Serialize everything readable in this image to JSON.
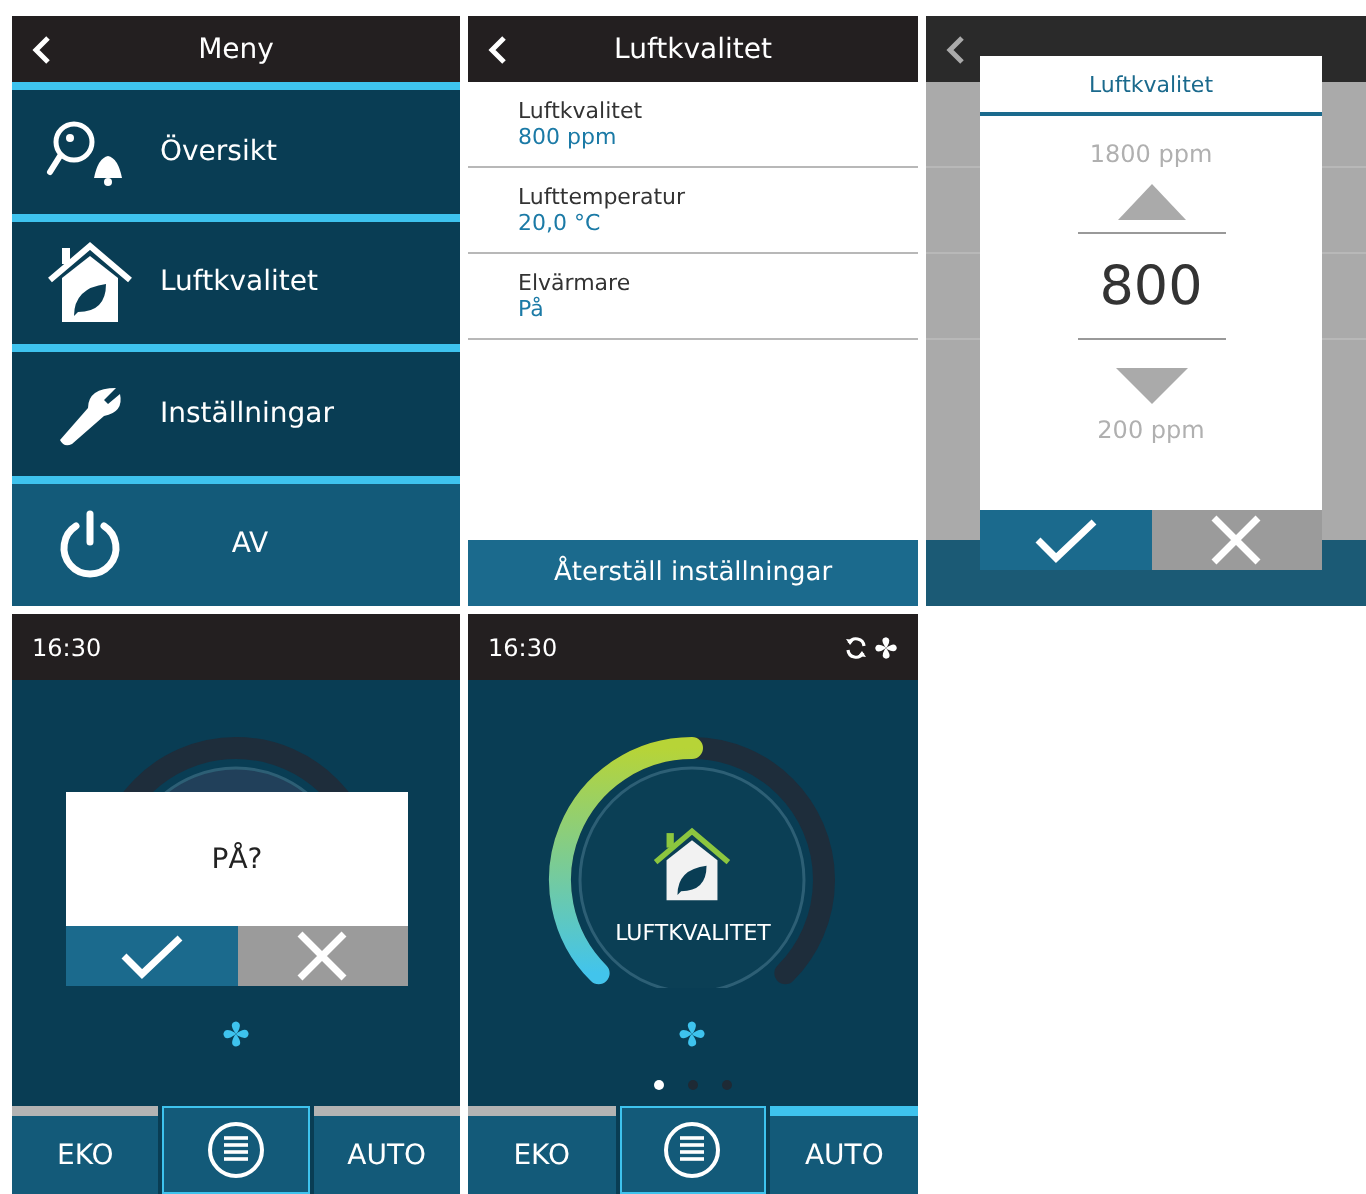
{
  "menu_screen": {
    "title": "Meny",
    "items": [
      {
        "kind": "overview",
        "label": "Översikt"
      },
      {
        "kind": "air",
        "label": "Luftkvalitet"
      },
      {
        "kind": "settings",
        "label": "Inställningar"
      },
      {
        "kind": "power",
        "label": "AV"
      }
    ]
  },
  "settings_screen": {
    "title": "Luftkvalitet",
    "rows": [
      {
        "label": "Luftkvalitet",
        "value": "800 ppm"
      },
      {
        "label": "Lufttemperatur",
        "value": "20,0 °C"
      },
      {
        "label": "Elvärmare",
        "value": "På"
      }
    ],
    "footer_button": "Återställ inställningar"
  },
  "picker_screen": {
    "dialog": {
      "title": "Luftkvalitet",
      "upper": "1800 ppm",
      "value": "800",
      "lower": "200 ppm"
    }
  },
  "confirm_screen": {
    "time": "16:30",
    "question": "PÅ?",
    "modes": [
      {
        "kind": "mode",
        "label": "EKO",
        "selected": false
      },
      {
        "kind": "menu"
      },
      {
        "kind": "mode",
        "label": "AUTO",
        "selected": false
      }
    ]
  },
  "home_screen": {
    "time": "16:30",
    "gauge": {
      "label": "LUFTKVALITET"
    },
    "pages": [
      {
        "selected": true
      },
      {
        "selected": false
      },
      {
        "selected": false
      }
    ],
    "modes": [
      {
        "kind": "mode",
        "label": "EKO",
        "selected": false
      },
      {
        "kind": "menu"
      },
      {
        "kind": "mode",
        "label": "AUTO",
        "selected": true
      }
    ]
  }
}
